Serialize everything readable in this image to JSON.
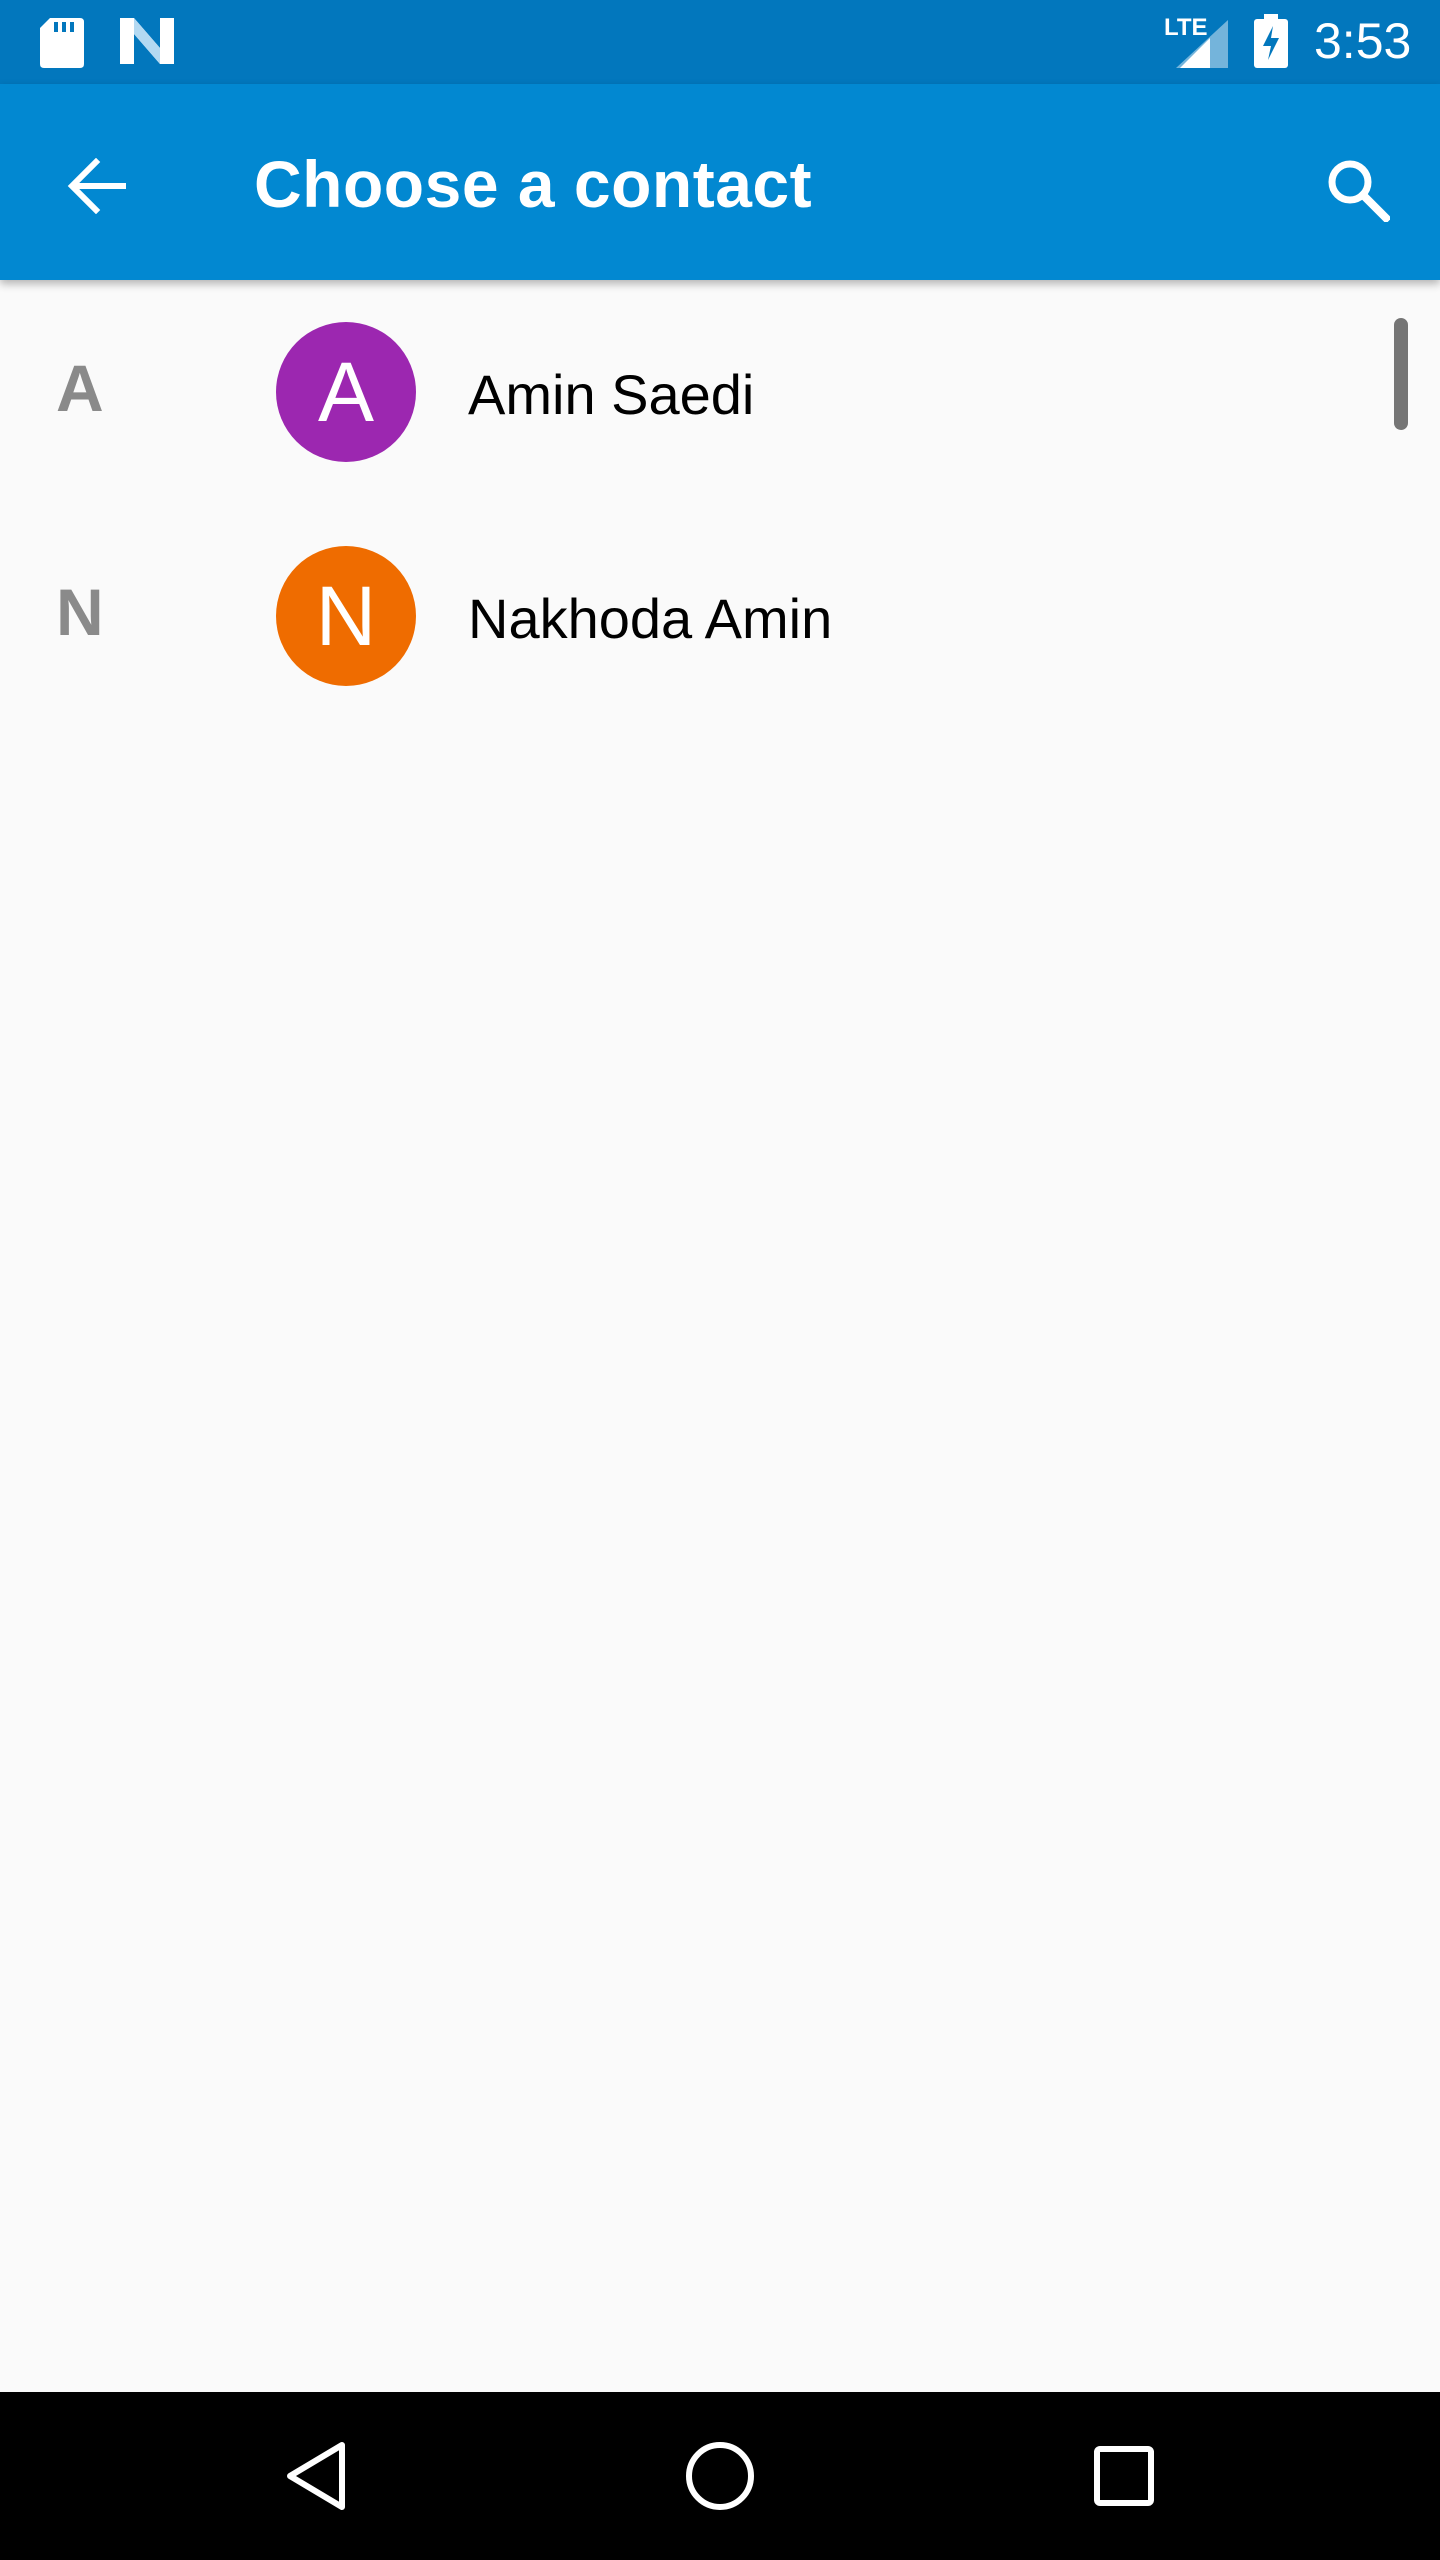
{
  "status_bar": {
    "network_label": "LTE",
    "time": "3:53",
    "icons": [
      "sd-card-icon",
      "n-logo-icon",
      "lte-signal-icon",
      "battery-charging-icon"
    ]
  },
  "app_bar": {
    "title": "Choose a contact",
    "back_icon": "arrow-back-icon",
    "search_icon": "search-icon",
    "background_color": "#0288d1"
  },
  "contacts": [
    {
      "section": "A",
      "initial": "A",
      "name": "Amin Saedi",
      "avatar_color": "#9c27b0"
    },
    {
      "section": "N",
      "initial": "N",
      "name": "Nakhoda Amin",
      "avatar_color": "#ef6c00"
    }
  ],
  "nav_bar": {
    "icons": [
      "back-triangle-icon",
      "home-circle-icon",
      "recents-square-icon"
    ]
  }
}
